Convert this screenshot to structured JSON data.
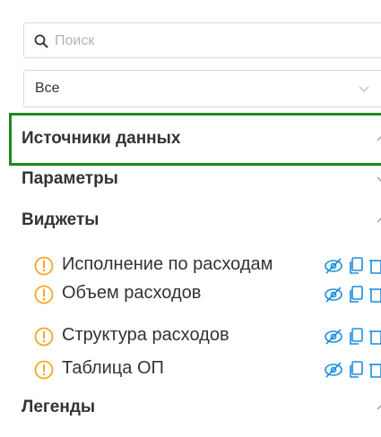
{
  "search": {
    "placeholder": "Поиск",
    "value": ""
  },
  "filter": {
    "selected": "Все"
  },
  "sections": {
    "data_sources": {
      "label": "Источники данных",
      "expanded": true
    },
    "parameters": {
      "label": "Параметры",
      "expanded": false
    },
    "widgets": {
      "label": "Виджеты",
      "expanded": true
    },
    "legends": {
      "label": "Легенды",
      "expanded": true
    }
  },
  "widgets": [
    {
      "name": "Исполнение по расходам",
      "status": "warning"
    },
    {
      "name": "Объем расходов",
      "status": "warning"
    },
    {
      "name": "Структура расходов",
      "status": "warning"
    },
    {
      "name": "Таблица ОП",
      "status": "warning"
    }
  ],
  "colors": {
    "accent": "#1a8de0",
    "warning": "#f5a623",
    "highlight": "#1a8a1a",
    "text": "#333333"
  }
}
